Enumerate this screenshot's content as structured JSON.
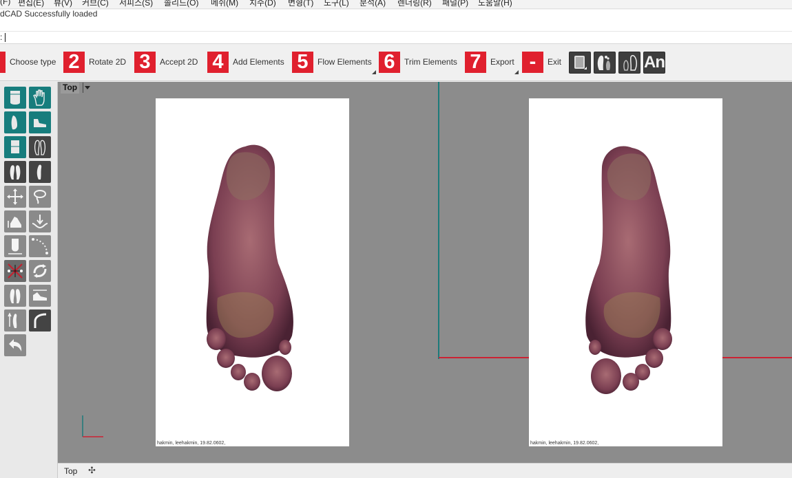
{
  "menu": [
    "(F)",
    "편집(E)",
    "뷰(V)",
    "커브(C)",
    "서피스(S)",
    "솔리드(O)",
    "메쉬(M)",
    "치수(D)",
    "변형(T)",
    "도구(L)",
    "분석(A)",
    "렌더링(R)",
    "패널(P)",
    "도움말(H)"
  ],
  "history": {
    "line": "dCAD Successfully loaded"
  },
  "command": {
    "prompt": ":"
  },
  "steps": [
    {
      "num": "",
      "label": "Choose type"
    },
    {
      "num": "2",
      "label": "Rotate 2D"
    },
    {
      "num": "3",
      "label": "Accept 2D"
    },
    {
      "num": "4",
      "label": "Add Elements"
    },
    {
      "num": "5",
      "label": "Flow Elements"
    },
    {
      "num": "6",
      "label": "Trim Elements"
    },
    {
      "num": "7",
      "label": "Export"
    },
    {
      "num": "-",
      "label": "Exit"
    }
  ],
  "toolbar_icons": [
    "book-icon",
    "left-foot-icon",
    "right-foot-icon",
    "an-icon"
  ],
  "an_label": "An",
  "viewport": {
    "title": "Top",
    "pictures": [
      {
        "caption": "hakmin, leehakmin, 19.82.0602,"
      },
      {
        "caption": "hakmin, leehakmin, 19.82.0602,"
      }
    ]
  },
  "tabs": {
    "active": "Top",
    "add": "✣"
  },
  "colors": {
    "accent_red": "#e0202e",
    "tool_teal": "#177d7d",
    "viewport_bg": "#8c8c8c",
    "axis_x": "#cc2233",
    "axis_y": "#1c7a7a",
    "foot": "#7b3f52"
  }
}
